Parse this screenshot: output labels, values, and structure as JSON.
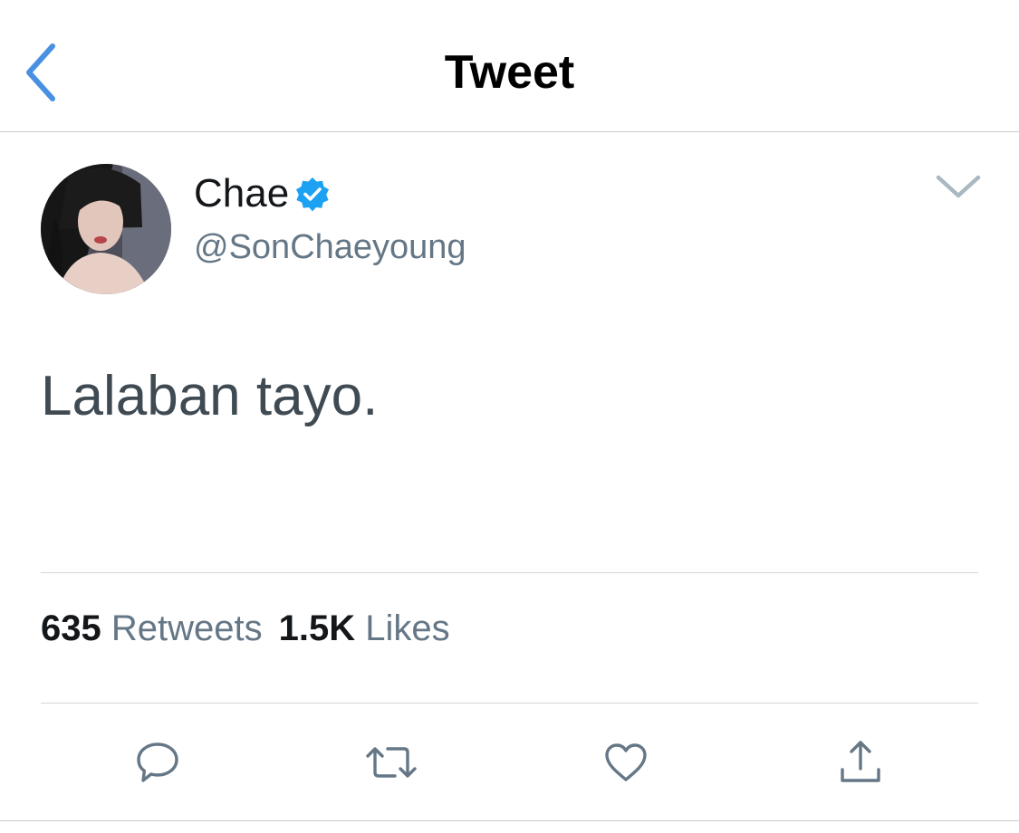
{
  "nav": {
    "title": "Tweet",
    "back_icon": "chevron-left-icon"
  },
  "author": {
    "display_name": "Chae",
    "handle": "@SonChaeyoung",
    "verified": true
  },
  "tweet": {
    "text": "Lalaban tayo."
  },
  "stats": {
    "retweets_count": "635",
    "retweets_label": "Retweets",
    "likes_count": "1.5K",
    "likes_label": "Likes"
  },
  "actions": [
    "reply-icon",
    "retweet-icon",
    "like-icon",
    "share-icon"
  ],
  "colors": {
    "accent": "#1da1f2",
    "back": "#4a90e2",
    "icon": "#657786",
    "text": "#14171a",
    "secondary": "#657786"
  }
}
